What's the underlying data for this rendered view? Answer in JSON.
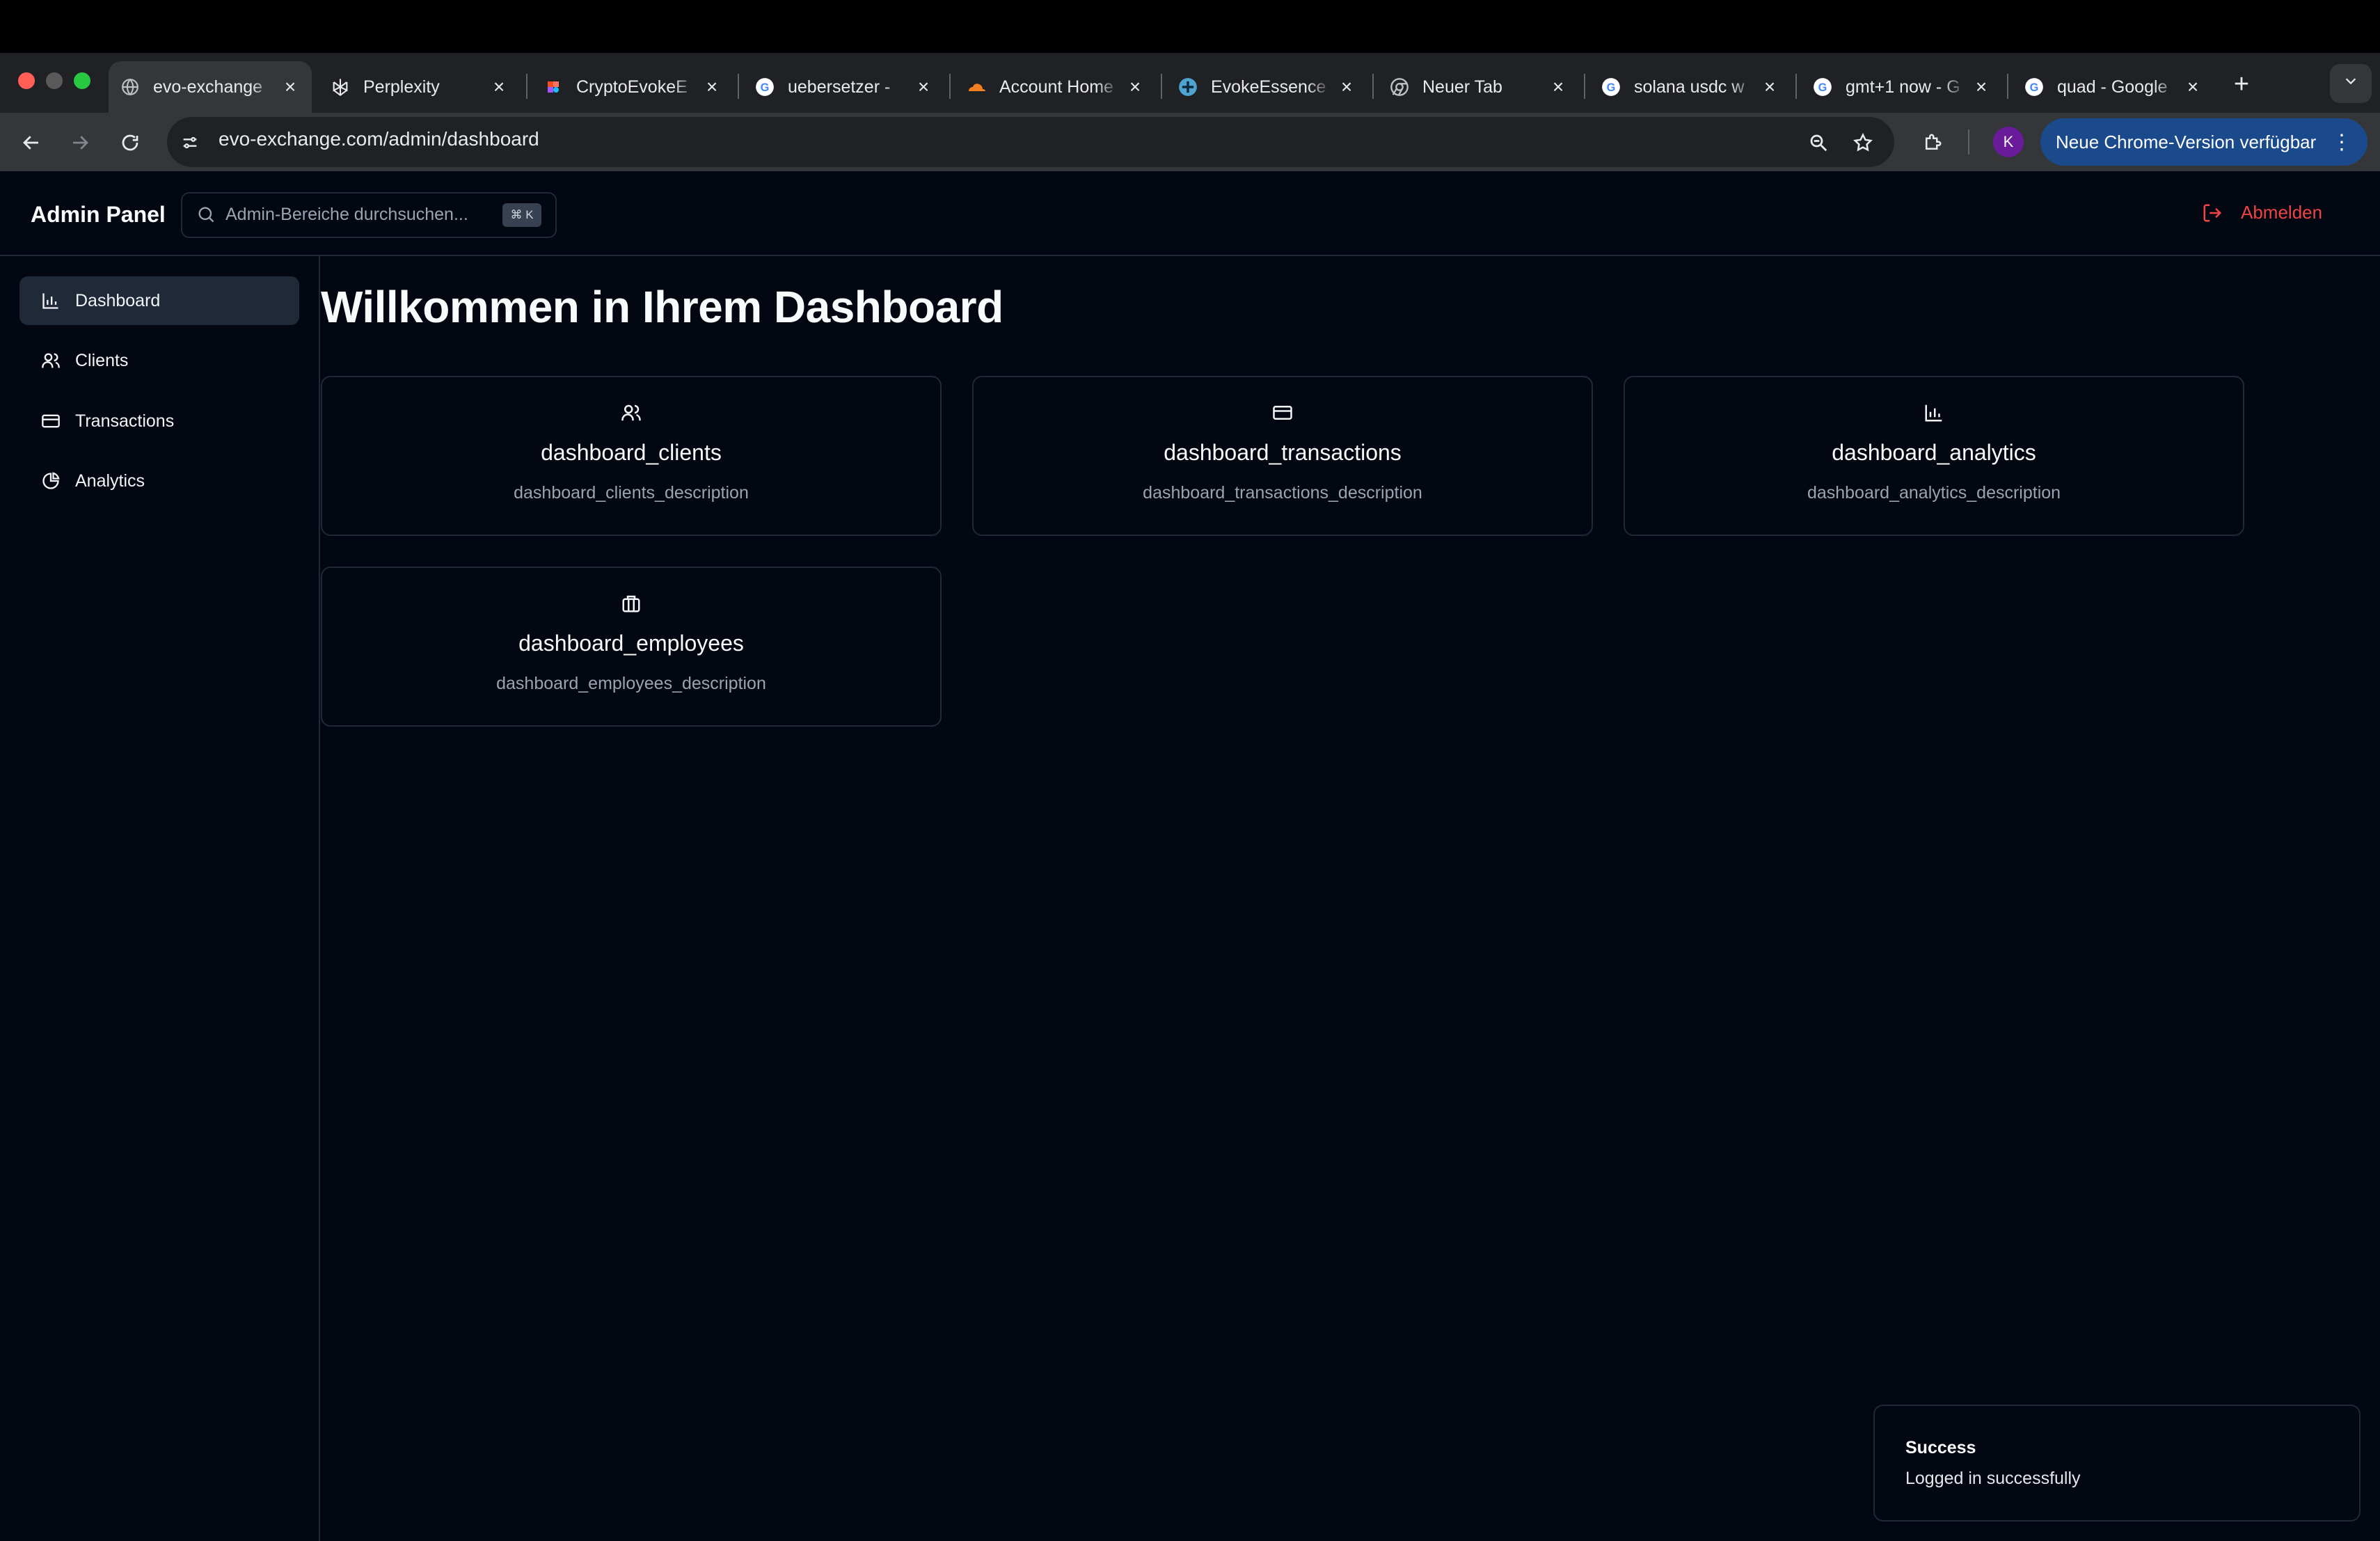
{
  "browser": {
    "tabs": [
      {
        "title": "evo-exchange",
        "icon": "globe-icon"
      },
      {
        "title": "Perplexity",
        "icon": "perplexity-icon"
      },
      {
        "title": "CryptoEvokeE",
        "icon": "figma-icon"
      },
      {
        "title": "uebersetzer -",
        "icon": "google-icon"
      },
      {
        "title": "Account Home",
        "icon": "cloudflare-icon"
      },
      {
        "title": "EvokeEssence",
        "icon": "plus-circle-icon"
      },
      {
        "title": "Neuer Tab",
        "icon": "chrome-icon"
      },
      {
        "title": "solana usdc w",
        "icon": "google-icon"
      },
      {
        "title": "gmt+1 now - G",
        "icon": "google-icon"
      },
      {
        "title": "quad - Google",
        "icon": "google-icon"
      }
    ],
    "url": "evo-exchange.com/admin/dashboard",
    "profile_initial": "K",
    "update_label": "Neue Chrome-Version verfügbar"
  },
  "header": {
    "brand": "Admin Panel",
    "search_placeholder": "Admin-Bereiche durchsuchen...",
    "shortcut": "⌘ K",
    "logout_label": "Abmelden"
  },
  "sidebar": {
    "items": [
      {
        "label": "Dashboard",
        "icon": "bar-chart-icon",
        "active": true
      },
      {
        "label": "Clients",
        "icon": "users-icon"
      },
      {
        "label": "Transactions",
        "icon": "credit-card-icon"
      },
      {
        "label": "Analytics",
        "icon": "pie-chart-icon"
      }
    ]
  },
  "main": {
    "title": "Willkommen in Ihrem Dashboard",
    "cards": [
      {
        "title": "dashboard_clients",
        "description": "dashboard_clients_description",
        "icon": "users-icon"
      },
      {
        "title": "dashboard_transactions",
        "description": "dashboard_transactions_description",
        "icon": "credit-card-icon"
      },
      {
        "title": "dashboard_analytics",
        "description": "dashboard_analytics_description",
        "icon": "bar-chart-icon"
      },
      {
        "title": "dashboard_employees",
        "description": "dashboard_employees_description",
        "icon": "briefcase-icon"
      }
    ]
  },
  "toast": {
    "title": "Success",
    "message": "Logged in successfully"
  },
  "colors": {
    "background": "#030712",
    "border": "#1f2937",
    "danger": "#ef4444",
    "muted_text": "#9ca3af"
  }
}
